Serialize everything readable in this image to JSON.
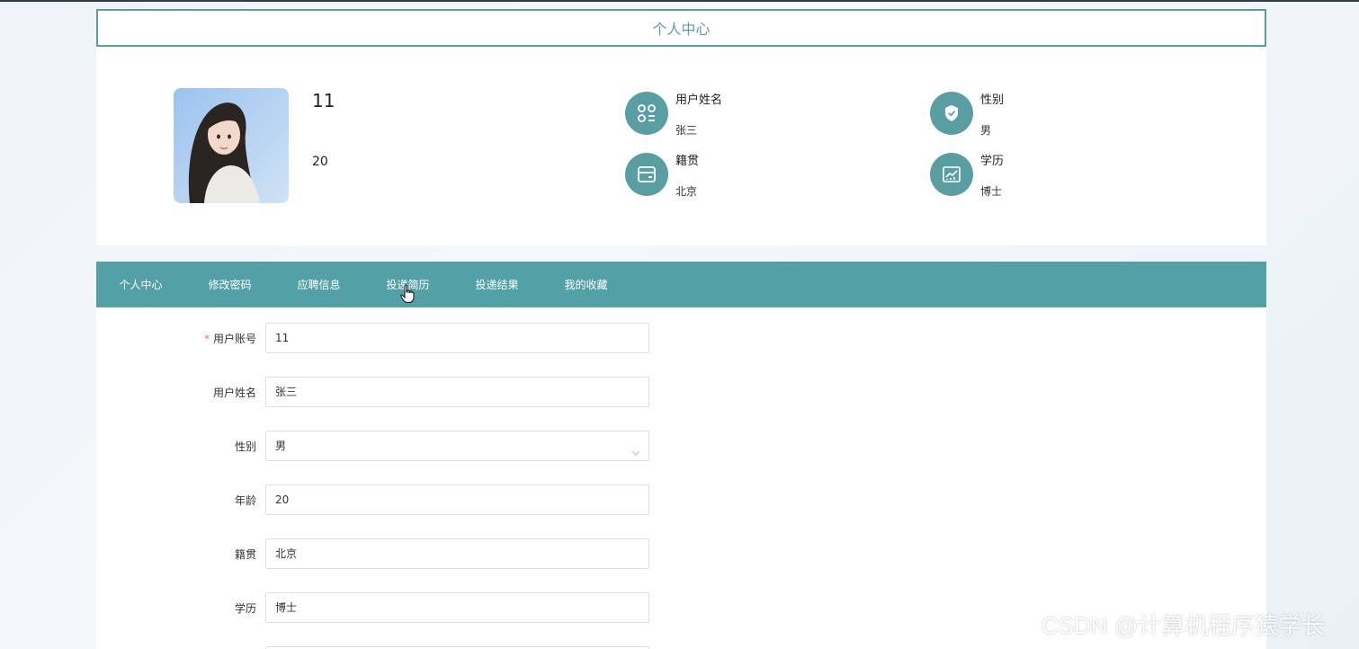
{
  "header": {
    "title": "个人中心"
  },
  "profile": {
    "username": "11",
    "age": "20",
    "info": [
      {
        "label": "用户姓名",
        "value": "张三",
        "icon": "apps-icon"
      },
      {
        "label": "性别",
        "value": "男",
        "icon": "shield-check-icon"
      },
      {
        "label": "籍贯",
        "value": "北京",
        "icon": "wallet-icon"
      },
      {
        "label": "学历",
        "value": "博士",
        "icon": "chart-icon"
      }
    ]
  },
  "nav": {
    "items": [
      "个人中心",
      "修改密码",
      "应聘信息",
      "投递简历",
      "投递结果",
      "我的收藏"
    ]
  },
  "form": {
    "account": {
      "label": "用户账号",
      "value": "11"
    },
    "name": {
      "label": "用户姓名",
      "value": "张三"
    },
    "gender": {
      "label": "性别",
      "value": "男"
    },
    "age": {
      "label": "年龄",
      "value": "20"
    },
    "hometown": {
      "label": "籍贯",
      "value": "北京"
    },
    "education": {
      "label": "学历",
      "value": "博士"
    }
  },
  "watermark": "CSDN @计算机程序猿学长",
  "colors": {
    "accent": "#53a0a6",
    "required": "#f56c6c"
  }
}
